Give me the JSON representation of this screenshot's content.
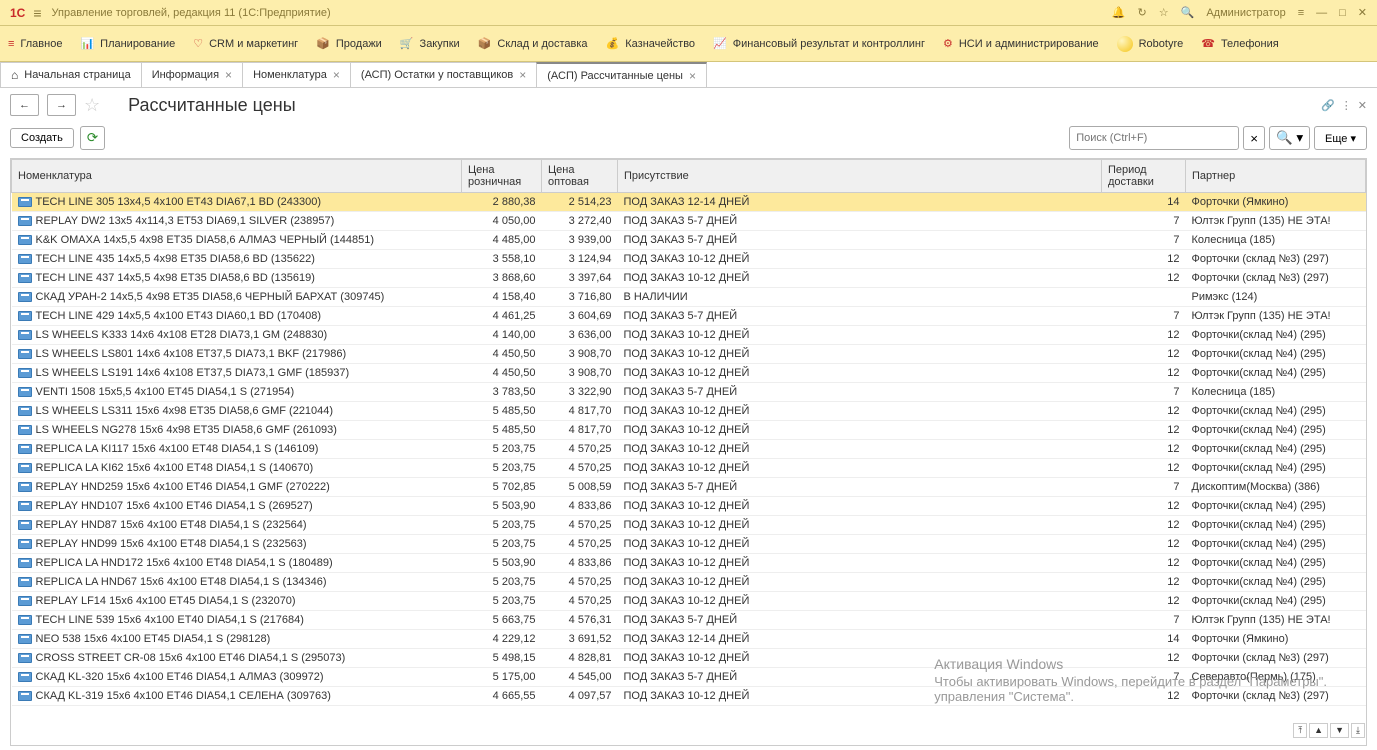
{
  "header": {
    "app_title": "Управление торговлей, редакция 11 (1С:Предприятие)",
    "user": "Администратор"
  },
  "menu": {
    "items": [
      {
        "label": "Главное"
      },
      {
        "label": "Планирование"
      },
      {
        "label": "CRM и маркетинг"
      },
      {
        "label": "Продажи"
      },
      {
        "label": "Закупки"
      },
      {
        "label": "Склад и доставка"
      },
      {
        "label": "Казначейство"
      },
      {
        "label": "Финансовый результат и контроллинг"
      },
      {
        "label": "НСИ и администрирование"
      },
      {
        "label": "Robotyre"
      },
      {
        "label": "Телефония"
      }
    ]
  },
  "tabs": {
    "items": [
      {
        "label": "Начальная страница",
        "home": true,
        "closable": false
      },
      {
        "label": "Информация",
        "closable": true
      },
      {
        "label": "Номенклатура",
        "closable": true
      },
      {
        "label": "(АСП) Остатки у поставщиков",
        "closable": true
      },
      {
        "label": "(АСП) Рассчитанные цены",
        "closable": true,
        "active": true
      }
    ]
  },
  "page": {
    "title": "Рассчитанные цены"
  },
  "actions": {
    "create": "Создать",
    "more": "Еще"
  },
  "search": {
    "placeholder": "Поиск (Ctrl+F)"
  },
  "columns": {
    "nom": "Номенклатура",
    "retail": "Цена розничная",
    "wholesale": "Цена оптовая",
    "presence": "Присутствие",
    "delivery": "Период доставки",
    "partner": "Партнер"
  },
  "rows": [
    {
      "nom": "TECH LINE 305 13x4,5 4x100 ET43 DIA67,1 BD (243300)",
      "retail": "2 880,38",
      "wholesale": "2 514,23",
      "presence": "ПОД ЗАКАЗ 12-14 ДНЕЙ",
      "delivery": "14",
      "partner": "Форточки (Ямкино)",
      "selected": true
    },
    {
      "nom": "REPLAY DW2 13x5 4x114,3 ET53 DIA69,1 SILVER (238957)",
      "retail": "4 050,00",
      "wholesale": "3 272,40",
      "presence": "ПОД ЗАКАЗ 5-7 ДНЕЙ",
      "delivery": "7",
      "partner": "Юлтэк Групп (135) НЕ ЭТА!"
    },
    {
      "nom": "K&K ОМАХА 14x5,5 4x98 ET35 DIA58,6 АЛМАЗ ЧЕРНЫЙ (144851)",
      "retail": "4 485,00",
      "wholesale": "3 939,00",
      "presence": "ПОД ЗАКАЗ 5-7 ДНЕЙ",
      "delivery": "7",
      "partner": "Колесница (185)"
    },
    {
      "nom": "TECH LINE 435 14x5,5 4x98 ET35 DIA58,6 BD (135622)",
      "retail": "3 558,10",
      "wholesale": "3 124,94",
      "presence": "ПОД ЗАКАЗ 10-12 ДНЕЙ",
      "delivery": "12",
      "partner": "Форточки (склад №3) (297)"
    },
    {
      "nom": "TECH LINE 437 14x5,5 4x98 ET35 DIA58,6 BD (135619)",
      "retail": "3 868,60",
      "wholesale": "3 397,64",
      "presence": "ПОД ЗАКАЗ 10-12 ДНЕЙ",
      "delivery": "12",
      "partner": "Форточки (склад №3) (297)"
    },
    {
      "nom": "СКАД УРАН-2 14x5,5 4x98 ET35 DIA58,6 ЧЕРНЫЙ БАРХАТ (309745)",
      "retail": "4 158,40",
      "wholesale": "3 716,80",
      "presence": "В НАЛИЧИИ",
      "delivery": "",
      "partner": "Римэкс (124)"
    },
    {
      "nom": "TECH LINE 429 14x5,5 4x100 ET43 DIA60,1 BD (170408)",
      "retail": "4 461,25",
      "wholesale": "3 604,69",
      "presence": "ПОД ЗАКАЗ 5-7 ДНЕЙ",
      "delivery": "7",
      "partner": "Юлтэк Групп (135) НЕ ЭТА!"
    },
    {
      "nom": "LS WHEELS K333 14x6 4x108 ET28 DIA73,1 GM (248830)",
      "retail": "4 140,00",
      "wholesale": "3 636,00",
      "presence": "ПОД ЗАКАЗ 10-12 ДНЕЙ",
      "delivery": "12",
      "partner": "Форточки(склад №4) (295)"
    },
    {
      "nom": "LS WHEELS LS801 14x6 4x108 ET37,5 DIA73,1 BKF (217986)",
      "retail": "4 450,50",
      "wholesale": "3 908,70",
      "presence": "ПОД ЗАКАЗ 10-12 ДНЕЙ",
      "delivery": "12",
      "partner": "Форточки(склад №4) (295)"
    },
    {
      "nom": "LS WHEELS LS191 14x6 4x108 ET37,5 DIA73,1 GMF (185937)",
      "retail": "4 450,50",
      "wholesale": "3 908,70",
      "presence": "ПОД ЗАКАЗ 10-12 ДНЕЙ",
      "delivery": "12",
      "partner": "Форточки(склад №4) (295)"
    },
    {
      "nom": "VENTI 1508 15x5,5 4x100 ET45 DIA54,1 S (271954)",
      "retail": "3 783,50",
      "wholesale": "3 322,90",
      "presence": "ПОД ЗАКАЗ 5-7 ДНЕЙ",
      "delivery": "7",
      "partner": "Колесница (185)"
    },
    {
      "nom": "LS WHEELS LS311 15x6 4x98 ET35 DIA58,6 GMF (221044)",
      "retail": "5 485,50",
      "wholesale": "4 817,70",
      "presence": "ПОД ЗАКАЗ 10-12 ДНЕЙ",
      "delivery": "12",
      "partner": "Форточки(склад №4) (295)"
    },
    {
      "nom": "LS WHEELS NG278 15x6 4x98 ET35 DIA58,6 GMF (261093)",
      "retail": "5 485,50",
      "wholesale": "4 817,70",
      "presence": "ПОД ЗАКАЗ 10-12 ДНЕЙ",
      "delivery": "12",
      "partner": "Форточки(склад №4) (295)"
    },
    {
      "nom": "REPLICA LA KI117 15x6 4x100 ET48 DIA54,1 S (146109)",
      "retail": "5 203,75",
      "wholesale": "4 570,25",
      "presence": "ПОД ЗАКАЗ 10-12 ДНЕЙ",
      "delivery": "12",
      "partner": "Форточки(склад №4) (295)"
    },
    {
      "nom": "REPLICA LA KI62 15x6 4x100 ET48 DIA54,1 S (140670)",
      "retail": "5 203,75",
      "wholesale": "4 570,25",
      "presence": "ПОД ЗАКАЗ 10-12 ДНЕЙ",
      "delivery": "12",
      "partner": "Форточки(склад №4) (295)"
    },
    {
      "nom": "REPLAY HND259 15x6 4x100 ET46 DIA54,1 GMF (270222)",
      "retail": "5 702,85",
      "wholesale": "5 008,59",
      "presence": "ПОД ЗАКАЗ 5-7 ДНЕЙ",
      "delivery": "7",
      "partner": "Дископтим(Москва) (386)"
    },
    {
      "nom": "REPLAY HND107 15x6 4x100 ET46 DIA54,1 S (269527)",
      "retail": "5 503,90",
      "wholesale": "4 833,86",
      "presence": "ПОД ЗАКАЗ 10-12 ДНЕЙ",
      "delivery": "12",
      "partner": "Форточки(склад №4) (295)"
    },
    {
      "nom": "REPLAY HND87 15x6 4x100 ET48 DIA54,1 S (232564)",
      "retail": "5 203,75",
      "wholesale": "4 570,25",
      "presence": "ПОД ЗАКАЗ 10-12 ДНЕЙ",
      "delivery": "12",
      "partner": "Форточки(склад №4) (295)"
    },
    {
      "nom": "REPLAY HND99 15x6 4x100 ET48 DIA54,1 S (232563)",
      "retail": "5 203,75",
      "wholesale": "4 570,25",
      "presence": "ПОД ЗАКАЗ 10-12 ДНЕЙ",
      "delivery": "12",
      "partner": "Форточки(склад №4) (295)"
    },
    {
      "nom": "REPLICA LA HND172 15x6 4x100 ET48 DIA54,1 S (180489)",
      "retail": "5 503,90",
      "wholesale": "4 833,86",
      "presence": "ПОД ЗАКАЗ 10-12 ДНЕЙ",
      "delivery": "12",
      "partner": "Форточки(склад №4) (295)"
    },
    {
      "nom": "REPLICA LA HND67 15x6 4x100 ET48 DIA54,1 S (134346)",
      "retail": "5 203,75",
      "wholesale": "4 570,25",
      "presence": "ПОД ЗАКАЗ 10-12 ДНЕЙ",
      "delivery": "12",
      "partner": "Форточки(склад №4) (295)"
    },
    {
      "nom": "REPLAY LF14 15x6 4x100 ET45 DIA54,1 S (232070)",
      "retail": "5 203,75",
      "wholesale": "4 570,25",
      "presence": "ПОД ЗАКАЗ 10-12 ДНЕЙ",
      "delivery": "12",
      "partner": "Форточки(склад №4) (295)"
    },
    {
      "nom": "TECH LINE 539 15x6 4x100 ET40 DIA54,1 S (217684)",
      "retail": "5 663,75",
      "wholesale": "4 576,31",
      "presence": "ПОД ЗАКАЗ 5-7 ДНЕЙ",
      "delivery": "7",
      "partner": "Юлтэк Групп (135) НЕ ЭТА!"
    },
    {
      "nom": "NEO 538 15x6 4x100 ET45 DIA54,1 S (298128)",
      "retail": "4 229,12",
      "wholesale": "3 691,52",
      "presence": "ПОД ЗАКАЗ 12-14 ДНЕЙ",
      "delivery": "14",
      "partner": "Форточки (Ямкино)"
    },
    {
      "nom": "CROSS STREET CR-08 15x6 4x100 ET46 DIA54,1 S (295073)",
      "retail": "5 498,15",
      "wholesale": "4 828,81",
      "presence": "ПОД ЗАКАЗ 10-12 ДНЕЙ",
      "delivery": "12",
      "partner": "Форточки (склад №3) (297)"
    },
    {
      "nom": "СКАД KL-320 15x6 4x100 ET46 DIA54,1 АЛМАЗ (309972)",
      "retail": "5 175,00",
      "wholesale": "4 545,00",
      "presence": "ПОД ЗАКАЗ 5-7 ДНЕЙ",
      "delivery": "7",
      "partner": "Северавто(Пермь) (175)"
    },
    {
      "nom": "СКАД KL-319 15x6 4x100 ET46 DIA54,1 СЕЛЕНА (309763)",
      "retail": "4 665,55",
      "wholesale": "4 097,57",
      "presence": "ПОД ЗАКАЗ 10-12 ДНЕЙ",
      "delivery": "12",
      "partner": "Форточки (склад №3) (297)"
    }
  ],
  "watermark": {
    "title": "Активация Windows",
    "text1": "Чтобы активировать Windows, перейдите в раздел \"Параметры\".",
    "text2": "управления \"Система\"."
  }
}
